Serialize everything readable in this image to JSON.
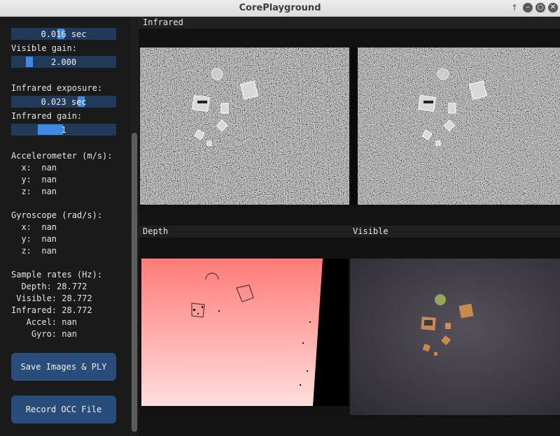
{
  "window": {
    "title": "CorePlayground"
  },
  "sidebar": {
    "visible_exposure_value": "0.016 sec",
    "visible_gain_label": "Visible gain:",
    "visible_gain_value": "2.000",
    "infrared_exposure_label": "Infrared exposure:",
    "infrared_exposure_value": "0.023 sec",
    "infrared_gain_label": "Infrared gain:",
    "infrared_gain_value": "1",
    "accelerometer": {
      "label": "Accelerometer (m/s):",
      "x": "  x:  nan",
      "y": "  y:  nan",
      "z": "  z:  nan"
    },
    "gyroscope": {
      "label": "Gyroscope (rad/s):",
      "x": "  x:  nan",
      "y": "  y:  nan",
      "z": "  z:  nan"
    },
    "sample_rates": {
      "label": "Sample rates (Hz):",
      "depth": "  Depth: 28.772",
      "visible": " Visible: 28.772",
      "infrared": "Infrared: 28.772",
      "accel": "   Accel: nan",
      "gyro": "    Gyro: nan"
    },
    "save_button": "Save Images & PLY",
    "record_button": "Record OCC File"
  },
  "views": {
    "infrared_title": "Infrared",
    "depth_title": "Depth",
    "visible_title": "Visible"
  },
  "colors": {
    "slider_bg": "#213a5a",
    "slider_grab": "#3d8ae6",
    "button_bg": "#284d7a",
    "depth_top": "#ff7b78",
    "depth_bottom": "#ffdedd"
  }
}
